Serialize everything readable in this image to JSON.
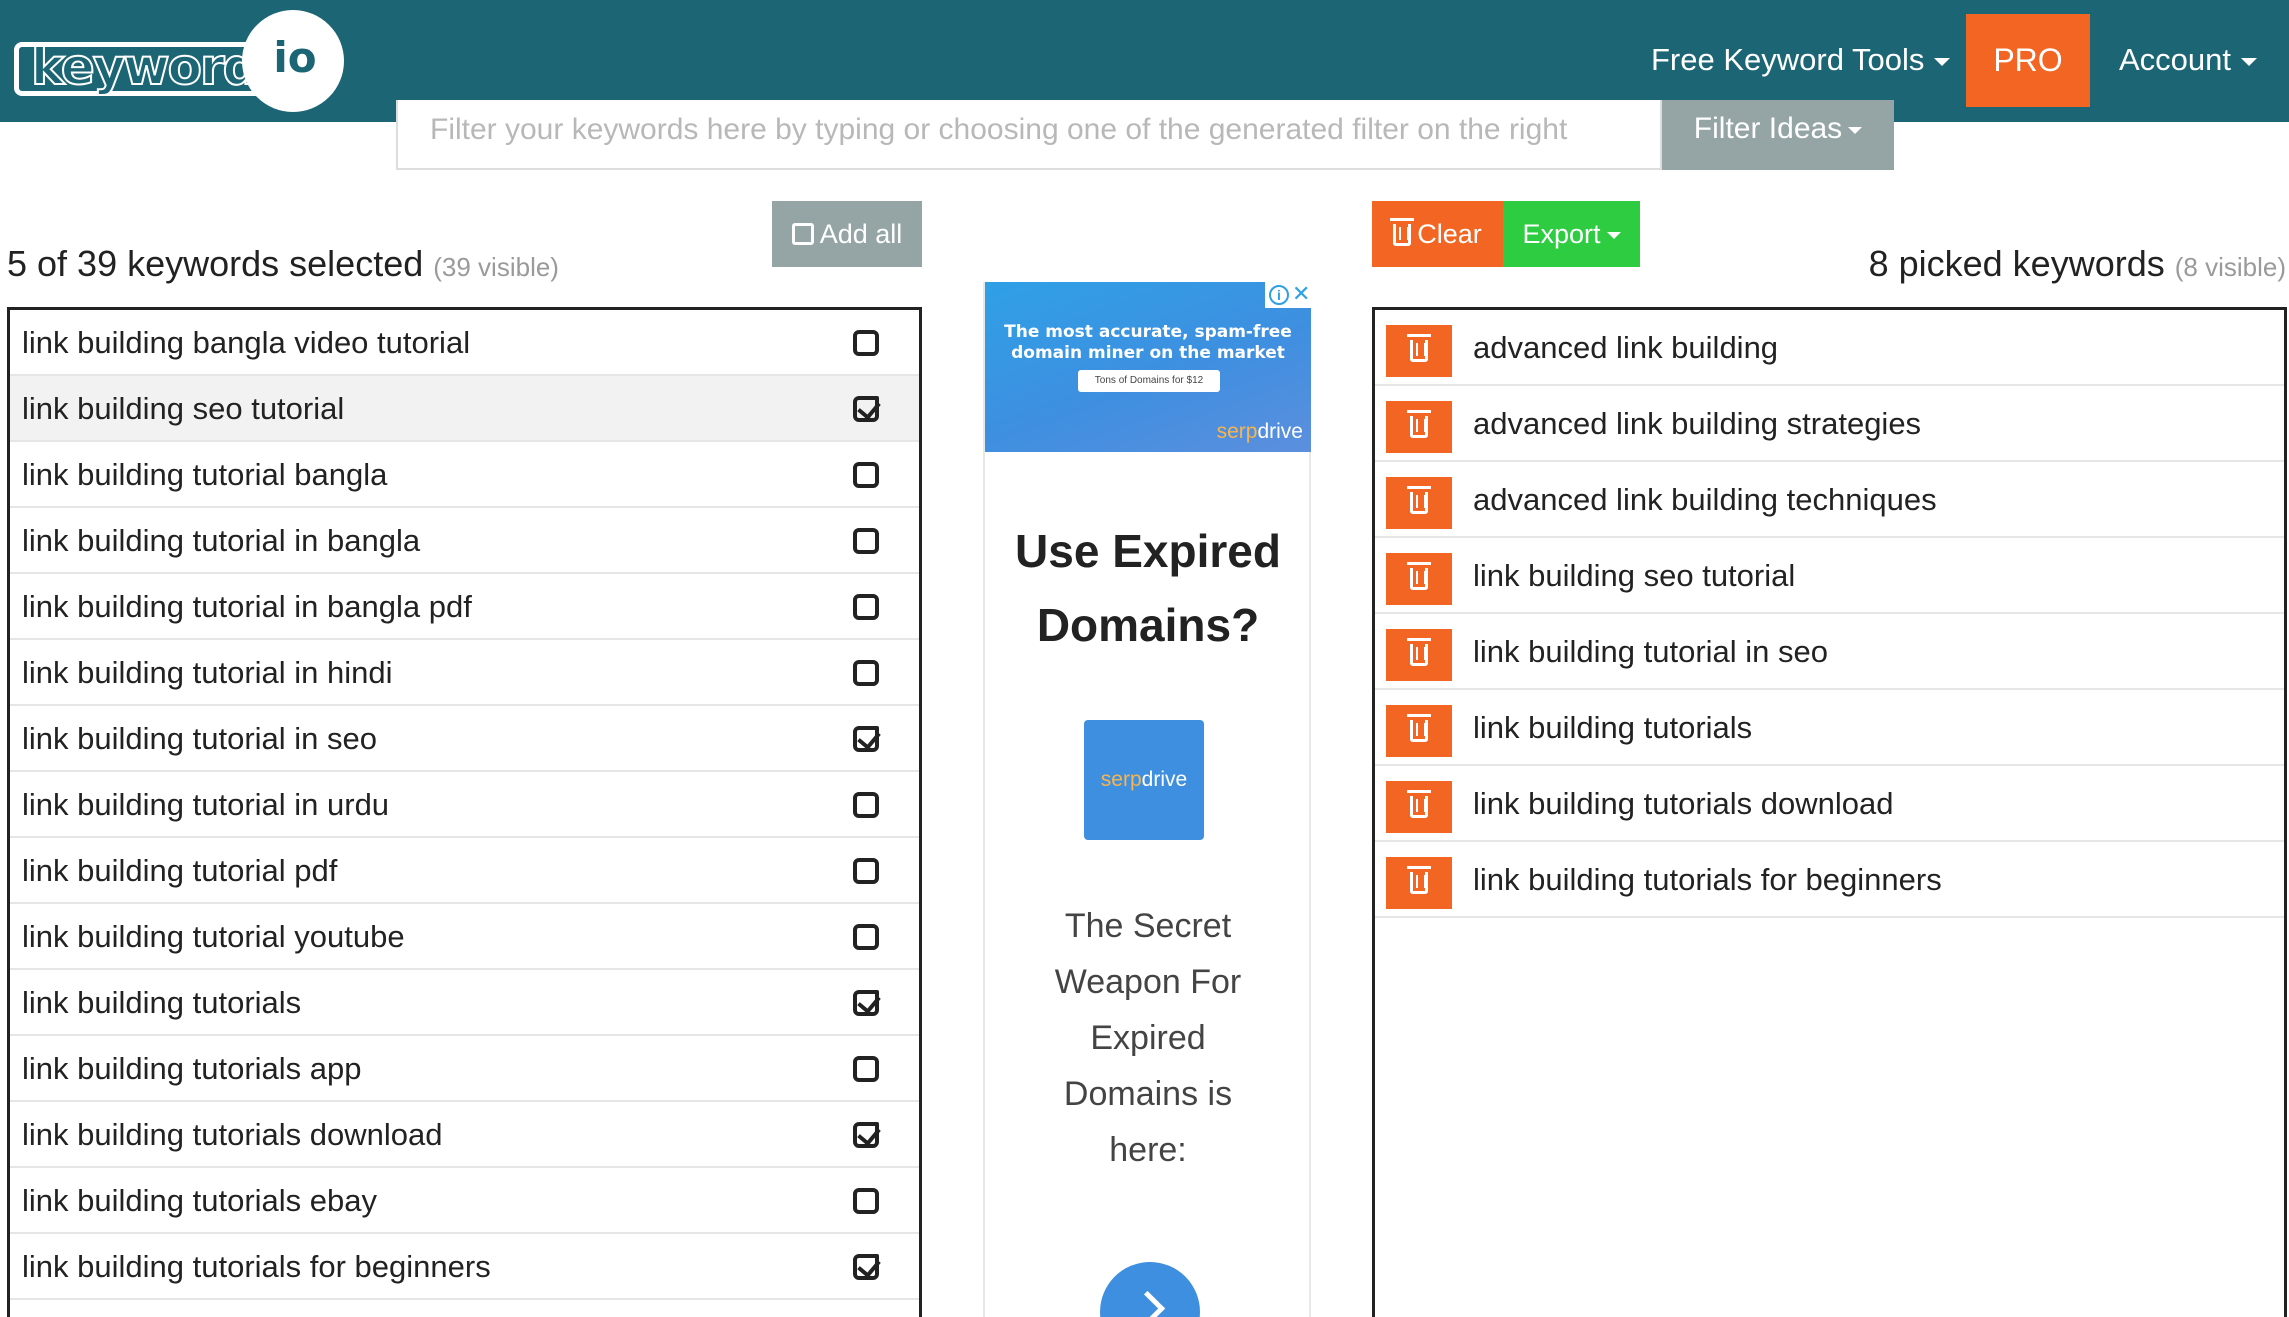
{
  "header": {
    "logo_word": "keyword",
    "logo_suffix": "io",
    "nav_tools": "Free Keyword Tools",
    "pro": "PRO",
    "account": "Account"
  },
  "filter": {
    "placeholder": "Filter your keywords here by typing or choosing one of the generated filter on the right",
    "button": "Filter Ideas"
  },
  "left": {
    "add_all": "Add all",
    "title": "5 of 39 keywords selected",
    "visible": "(39 visible)",
    "keywords": [
      {
        "text": "link building bangla video tutorial",
        "checked": false
      },
      {
        "text": "link building seo tutorial",
        "checked": true
      },
      {
        "text": "link building tutorial bangla",
        "checked": false
      },
      {
        "text": "link building tutorial in bangla",
        "checked": false
      },
      {
        "text": "link building tutorial in bangla pdf",
        "checked": false
      },
      {
        "text": "link building tutorial in hindi",
        "checked": false
      },
      {
        "text": "link building tutorial in seo",
        "checked": true
      },
      {
        "text": "link building tutorial in urdu",
        "checked": false
      },
      {
        "text": "link building tutorial pdf",
        "checked": false
      },
      {
        "text": "link building tutorial youtube",
        "checked": false
      },
      {
        "text": "link building tutorials",
        "checked": true
      },
      {
        "text": "link building tutorials app",
        "checked": false
      },
      {
        "text": "link building tutorials download",
        "checked": true
      },
      {
        "text": "link building tutorials ebay",
        "checked": false
      },
      {
        "text": "link building tutorials for beginners",
        "checked": true
      }
    ]
  },
  "ad": {
    "banner_line1": "The most accurate, spam-free",
    "banner_line2": "domain miner on the market",
    "banner_pill": "Tons of Domains for $12",
    "brand_a": "serp",
    "brand_b": "drive",
    "headline_1": "Use Expired",
    "headline_2": "Domains?",
    "body_1": "The Secret",
    "body_2": "Weapon For",
    "body_3": "Expired",
    "body_4": "Domains is",
    "body_5": "here:"
  },
  "right": {
    "clear": "Clear",
    "export": "Export",
    "title": "8 picked keywords",
    "visible": "(8 visible)",
    "picked": [
      "advanced link building",
      "advanced link building strategies",
      "advanced link building techniques",
      "link building seo tutorial",
      "link building tutorial in seo",
      "link building tutorials",
      "link building tutorials download",
      "link building tutorials for beginners"
    ]
  },
  "colors": {
    "header_bg": "#1b6574",
    "accent_orange": "#f26522",
    "export_green": "#2ecc40",
    "muted_gray": "#95a5a6",
    "ad_blue": "#3e8fe0"
  },
  "icons": [
    "check-square-icon",
    "checkbox-icon",
    "trash-icon",
    "caret-down-icon",
    "info-icon",
    "close-icon",
    "chevron-right-icon"
  ]
}
